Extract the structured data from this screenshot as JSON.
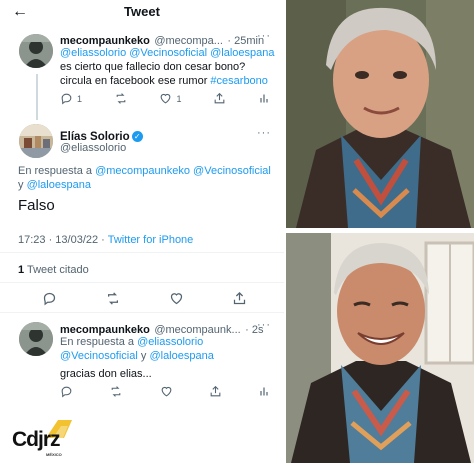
{
  "header": {
    "title": "Tweet"
  },
  "tweet1": {
    "name": "mecompaunkeko",
    "handle": "@mecompa...",
    "time": "· 25min",
    "line1_mentions": "@eliassolorio @Vecinosoficial @laloespana",
    "line2": "es cierto que fallecio don cesar bono?",
    "line3_text": "circula en facebook ese rumor",
    "line3_hashtag": "#cesarbono",
    "reply_count": "1",
    "like_count": "1"
  },
  "main_tweet": {
    "name": "Elías Solorio",
    "handle": "@eliassolorio",
    "reply_prefix": "En respuesta a",
    "reply_mentions_1": "@mecompaunkeko @Vecinosoficial",
    "reply_y": "y",
    "reply_mentions_2": "@laloespana",
    "body": "Falso",
    "timestamp": "17:23 · 13/03/22 ·",
    "client": "Twitter for iPhone",
    "quote_count": "1",
    "quote_label": "Tweet citado"
  },
  "tweet3": {
    "name": "mecompaunkeko",
    "handle": "@mecompaunk...",
    "time": "· 2s",
    "reply_prefix": "En respuesta a",
    "reply_mention_a": "@eliassolorio",
    "reply_mention_b": "@Vecinosoficial",
    "reply_y": "y",
    "reply_mention_c": "@laloespana",
    "body": "gracias don elias..."
  },
  "watermark": {
    "text": "Cdjrz",
    "sub": "MÉXICO"
  },
  "colors": {
    "accent": "#1d9bf0",
    "text": "#0f1419",
    "muted": "#536471",
    "gold": "#f2c230"
  }
}
